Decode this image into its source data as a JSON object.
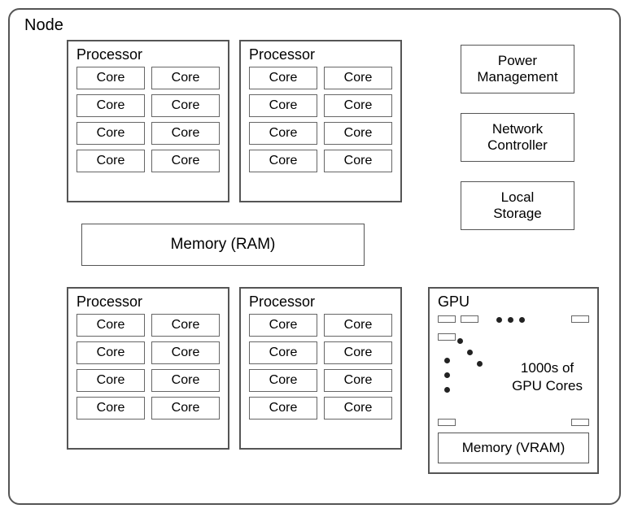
{
  "node": {
    "title": "Node"
  },
  "processor_label": "Processor",
  "core_label": "Core",
  "ram_label": "Memory (RAM)",
  "side": {
    "power": "Power\nManagement",
    "network": "Network\nController",
    "storage": "Local\nStorage"
  },
  "gpu": {
    "title": "GPU",
    "caption": "1000s of\nGPU Cores",
    "vram": "Memory (VRAM)"
  },
  "processors_count": 4,
  "cores_per_processor": 8
}
